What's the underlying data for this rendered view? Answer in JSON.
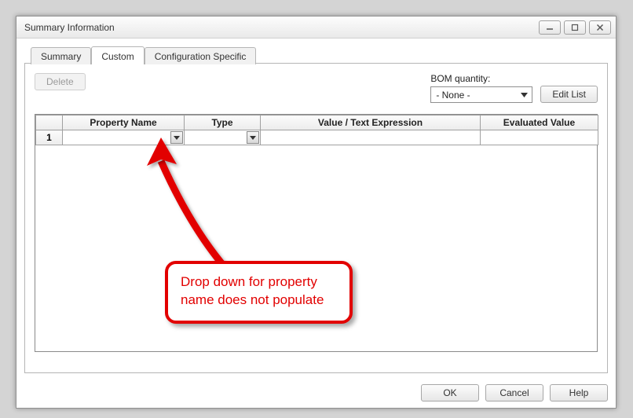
{
  "window": {
    "title": "Summary Information"
  },
  "tabs": {
    "summary": "Summary",
    "custom": "Custom",
    "config": "Configuration Specific"
  },
  "toolbar": {
    "delete_label": "Delete",
    "bom_label": "BOM quantity:",
    "bom_value": "- None -",
    "edit_list_label": "Edit List"
  },
  "grid": {
    "headers": {
      "rownum": "",
      "property_name": "Property Name",
      "type": "Type",
      "value_expr": "Value / Text Expression",
      "evaluated": "Evaluated Value"
    },
    "rows": [
      {
        "num": "1",
        "property_name": "",
        "type": "",
        "value_expr": "",
        "evaluated": ""
      }
    ]
  },
  "dialog_buttons": {
    "ok": "OK",
    "cancel": "Cancel",
    "help": "Help"
  },
  "annotation": {
    "text": "Drop down for property name does not populate"
  }
}
